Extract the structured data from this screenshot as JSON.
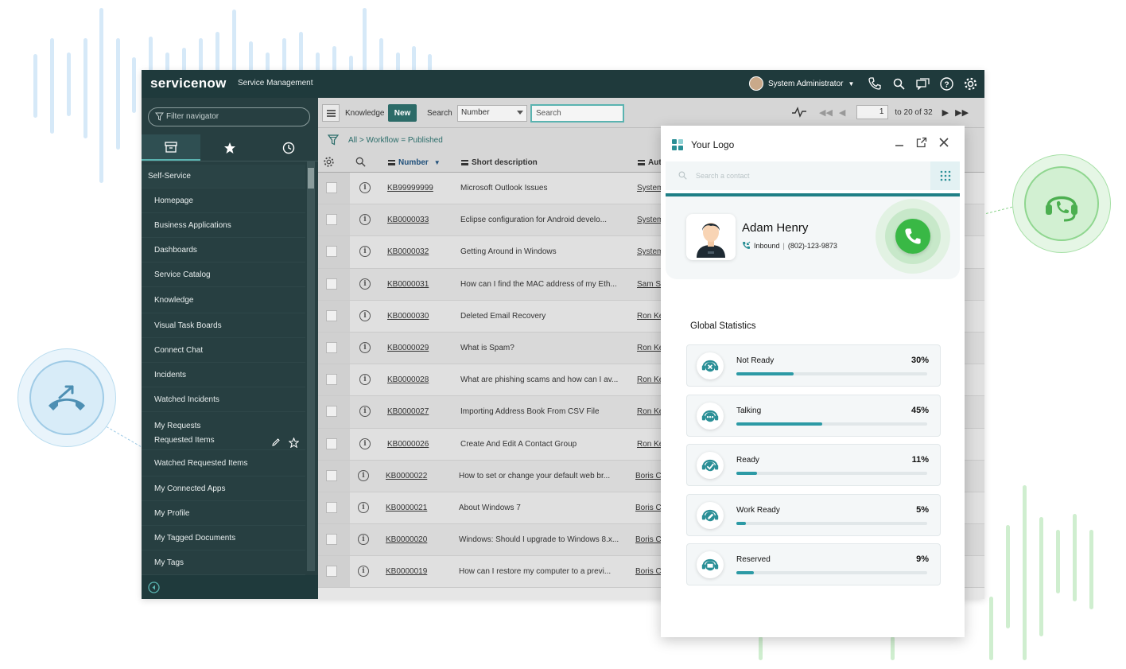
{
  "header": {
    "brand": "servicenow",
    "subtitle": "Service Management",
    "user_name": "System Administrator"
  },
  "sidebar": {
    "filter_placeholder": "Filter navigator",
    "section": "Self-Service",
    "items": [
      {
        "label": "Homepage"
      },
      {
        "label": "Business Applications"
      },
      {
        "label": "Dashboards"
      },
      {
        "label": "Service Catalog"
      },
      {
        "label": "Knowledge"
      },
      {
        "label": "Visual Task Boards"
      },
      {
        "label": "Connect Chat"
      },
      {
        "label": "Incidents"
      },
      {
        "label": "Watched Incidents"
      },
      {
        "label": "My Requests"
      },
      {
        "label": "Requested Items"
      },
      {
        "label": "Watched Requested Items"
      },
      {
        "label": "My Connected Apps"
      },
      {
        "label": "My Profile"
      },
      {
        "label": "My Tagged Documents"
      },
      {
        "label": "My Tags"
      }
    ]
  },
  "list": {
    "title": "Knowledge",
    "new_label": "New",
    "search_label": "Search",
    "search_field": "Number",
    "search_placeholder": "Search",
    "page_value": "1",
    "page_range": "to 20 of 32",
    "breadcrumb": "All > Workflow = Published",
    "columns": {
      "number": "Number",
      "short_description": "Short description",
      "author": "Auth"
    },
    "rows": [
      {
        "number": "KB99999999",
        "desc": "Microsoft Outlook Issues",
        "author": "System"
      },
      {
        "number": "KB0000033",
        "desc": "Eclipse configuration for Android develo...",
        "author": "System"
      },
      {
        "number": "KB0000032",
        "desc": "Getting Around in Windows",
        "author": "System"
      },
      {
        "number": "KB0000031",
        "desc": "How can I find the MAC address of my Eth...",
        "author": "Sam Sc"
      },
      {
        "number": "KB0000030",
        "desc": "Deleted Email Recovery",
        "author": "Ron Ke"
      },
      {
        "number": "KB0000029",
        "desc": "What is Spam?",
        "author": "Ron Ke"
      },
      {
        "number": "KB0000028",
        "desc": "What are phishing scams and how can I av...",
        "author": "Ron Ke"
      },
      {
        "number": "KB0000027",
        "desc": "Importing Address Book From CSV File",
        "author": "Ron Ke"
      },
      {
        "number": "KB0000026",
        "desc": "Create And Edit A Contact Group",
        "author": "Ron Ke"
      },
      {
        "number": "KB0000022",
        "desc": "How to set or change your default web br...",
        "author": "Boris Ca"
      },
      {
        "number": "KB0000021",
        "desc": "About Windows 7",
        "author": "Boris Ca"
      },
      {
        "number": "KB0000020",
        "desc": "Windows: Should I upgrade to Windows 8.x...",
        "author": "Boris Ca"
      },
      {
        "number": "KB0000019",
        "desc": "How can I restore my computer to a previ...",
        "author": "Boris Ca"
      }
    ]
  },
  "widget": {
    "title": "Your Logo",
    "search_placeholder": "Search a contact",
    "contact": {
      "name": "Adam Henry",
      "direction": "Inbound",
      "phone": "(802)-123-9873"
    },
    "stats_title": "Global Statistics",
    "stats": [
      {
        "label": "Not Ready",
        "pct_text": "30%",
        "value": 0.3,
        "icon": "headset-x-icon"
      },
      {
        "label": "Talking",
        "pct_text": "45%",
        "value": 0.45,
        "icon": "headset-chat-icon"
      },
      {
        "label": "Ready",
        "pct_text": "11%",
        "value": 0.11,
        "icon": "headset-check-icon"
      },
      {
        "label": "Work Ready",
        "pct_text": "5%",
        "value": 0.05,
        "icon": "headset-edit-icon"
      },
      {
        "label": "Reserved",
        "pct_text": "9%",
        "value": 0.09,
        "icon": "headset-box-icon"
      }
    ]
  },
  "colors": {
    "accent": "#2c9aa5",
    "nav_bg": "#273f41",
    "call_green": "#39b845"
  }
}
